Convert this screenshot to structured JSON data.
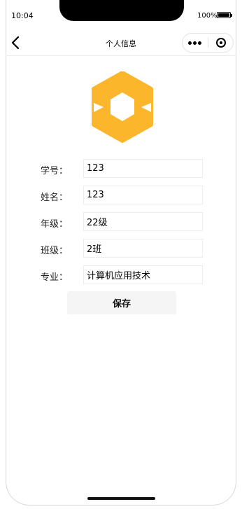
{
  "status_bar": {
    "time": "10:04",
    "battery_percent": "100%"
  },
  "nav": {
    "title": "个人信息"
  },
  "form": {
    "fields": [
      {
        "label": "学号：",
        "value": "123"
      },
      {
        "label": "姓名：",
        "value": "123"
      },
      {
        "label": "年级：",
        "value": "22级"
      },
      {
        "label": "班级：",
        "value": "2班"
      },
      {
        "label": "专业：",
        "value": "计算机应用技术"
      }
    ],
    "save_label": "保存"
  },
  "colors": {
    "logo": "#FBB62B",
    "button_bg": "#F5F5F5"
  },
  "icons": [
    "back-arrow-icon",
    "more-dots-icon",
    "close-target-icon",
    "star-logo-icon"
  ]
}
